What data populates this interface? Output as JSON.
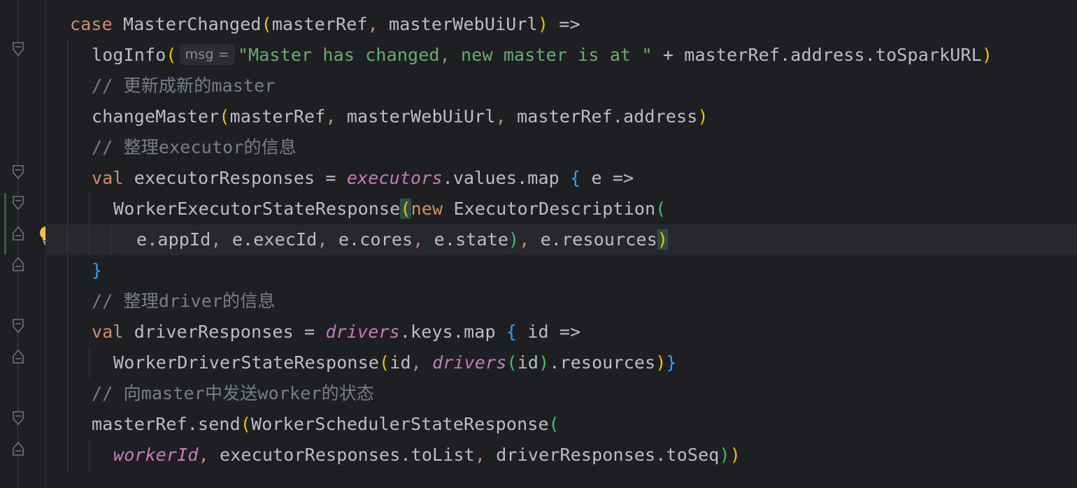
{
  "editor": {
    "lines": [
      {
        "id": "l1",
        "tokens": [
          [
            "kw",
            "case"
          ],
          [
            "t",
            " MasterChanged"
          ],
          [
            "p1",
            "("
          ],
          [
            "t",
            "masterRef"
          ],
          [
            "kw",
            ","
          ],
          [
            "t",
            " masterWebUiUrl"
          ],
          [
            "p1",
            ")"
          ],
          [
            "t",
            " =>"
          ]
        ]
      },
      {
        "id": "l2",
        "tokens": [
          [
            "t",
            "logInfo"
          ],
          [
            "p1",
            "("
          ],
          [
            "hint",
            "msg ="
          ],
          [
            "str",
            "\"Master has changed, new master is at \""
          ],
          [
            "t",
            " + masterRef.address.toSparkURL"
          ],
          [
            "p1",
            ")"
          ]
        ]
      },
      {
        "id": "l3",
        "tokens": [
          [
            "cmt",
            "// 更新成新的master"
          ]
        ]
      },
      {
        "id": "l4",
        "tokens": [
          [
            "t",
            "changeMaster"
          ],
          [
            "p1",
            "("
          ],
          [
            "t",
            "masterRef"
          ],
          [
            "kw",
            ","
          ],
          [
            "t",
            " masterWebUiUrl"
          ],
          [
            "kw",
            ","
          ],
          [
            "t",
            " masterRef.address"
          ],
          [
            "p1",
            ")"
          ]
        ]
      },
      {
        "id": "l5",
        "tokens": [
          [
            "cmt",
            "// 整理executor的信息"
          ]
        ]
      },
      {
        "id": "l6",
        "tokens": [
          [
            "kw",
            "val"
          ],
          [
            "t",
            " executorResponses = "
          ],
          [
            "field",
            "executors"
          ],
          [
            "t",
            ".values.map "
          ],
          [
            "brace",
            "{"
          ],
          [
            "t",
            " e =>"
          ]
        ]
      },
      {
        "id": "l7",
        "tokens": [
          [
            "t",
            "WorkerExecutorStateResponse"
          ],
          [
            "p1m",
            "("
          ],
          [
            "kw",
            "new"
          ],
          [
            "t",
            " ExecutorDescription"
          ],
          [
            "p4",
            "("
          ]
        ]
      },
      {
        "id": "l8",
        "tokens": [
          [
            "t",
            "e.appId"
          ],
          [
            "kw",
            ","
          ],
          [
            "t",
            " e.execId"
          ],
          [
            "kw",
            ","
          ],
          [
            "t",
            " e.cores"
          ],
          [
            "kw",
            ","
          ],
          [
            "t",
            " e.state"
          ],
          [
            "p4",
            ")"
          ],
          [
            "kw",
            ","
          ],
          [
            "t",
            " e.resources"
          ],
          [
            "p1m",
            ")"
          ]
        ]
      },
      {
        "id": "l9",
        "tokens": [
          [
            "brace",
            "}"
          ]
        ]
      },
      {
        "id": "l10",
        "tokens": [
          [
            "cmt",
            "// 整理driver的信息"
          ]
        ]
      },
      {
        "id": "l11",
        "tokens": [
          [
            "kw",
            "val"
          ],
          [
            "t",
            " driverResponses = "
          ],
          [
            "field",
            "drivers"
          ],
          [
            "t",
            ".keys.map "
          ],
          [
            "brace",
            "{"
          ],
          [
            "t",
            " id =>"
          ]
        ]
      },
      {
        "id": "l12",
        "tokens": [
          [
            "t",
            "WorkerDriverStateResponse"
          ],
          [
            "p1",
            "("
          ],
          [
            "t",
            "id"
          ],
          [
            "kw",
            ","
          ],
          [
            "t",
            " "
          ],
          [
            "field",
            "drivers"
          ],
          [
            "p4",
            "("
          ],
          [
            "t",
            "id"
          ],
          [
            "p4",
            ")"
          ],
          [
            "t",
            ".resources"
          ],
          [
            "p1",
            ")"
          ],
          [
            "brace",
            "}"
          ]
        ]
      },
      {
        "id": "l13",
        "tokens": [
          [
            "cmt",
            "// 向master中发送worker的状态"
          ]
        ]
      },
      {
        "id": "l14",
        "tokens": [
          [
            "t",
            "masterRef.send"
          ],
          [
            "p1",
            "("
          ],
          [
            "t",
            "WorkerSchedulerStateResponse"
          ],
          [
            "p4",
            "("
          ]
        ]
      },
      {
        "id": "l15",
        "tokens": [
          [
            "field",
            "workerId"
          ],
          [
            "kw",
            ","
          ],
          [
            "t",
            " executorResponses.toList"
          ],
          [
            "kw",
            ","
          ],
          [
            "t",
            " driverResponses.toSeq"
          ],
          [
            "p4",
            ")"
          ],
          [
            "p1",
            ")"
          ]
        ]
      }
    ]
  },
  "gutter": {
    "intention_icon": "lightbulb-icon",
    "fold_icons": "fold-marker-icon"
  },
  "colors": {
    "background": "#1e1f22",
    "keyword": "#cf8e6d",
    "string": "#6aab73",
    "comment": "#7a7e85",
    "field": "#c77dbb",
    "bracket_yellow": "#f0c300",
    "brace_blue": "#2fa0ff"
  }
}
